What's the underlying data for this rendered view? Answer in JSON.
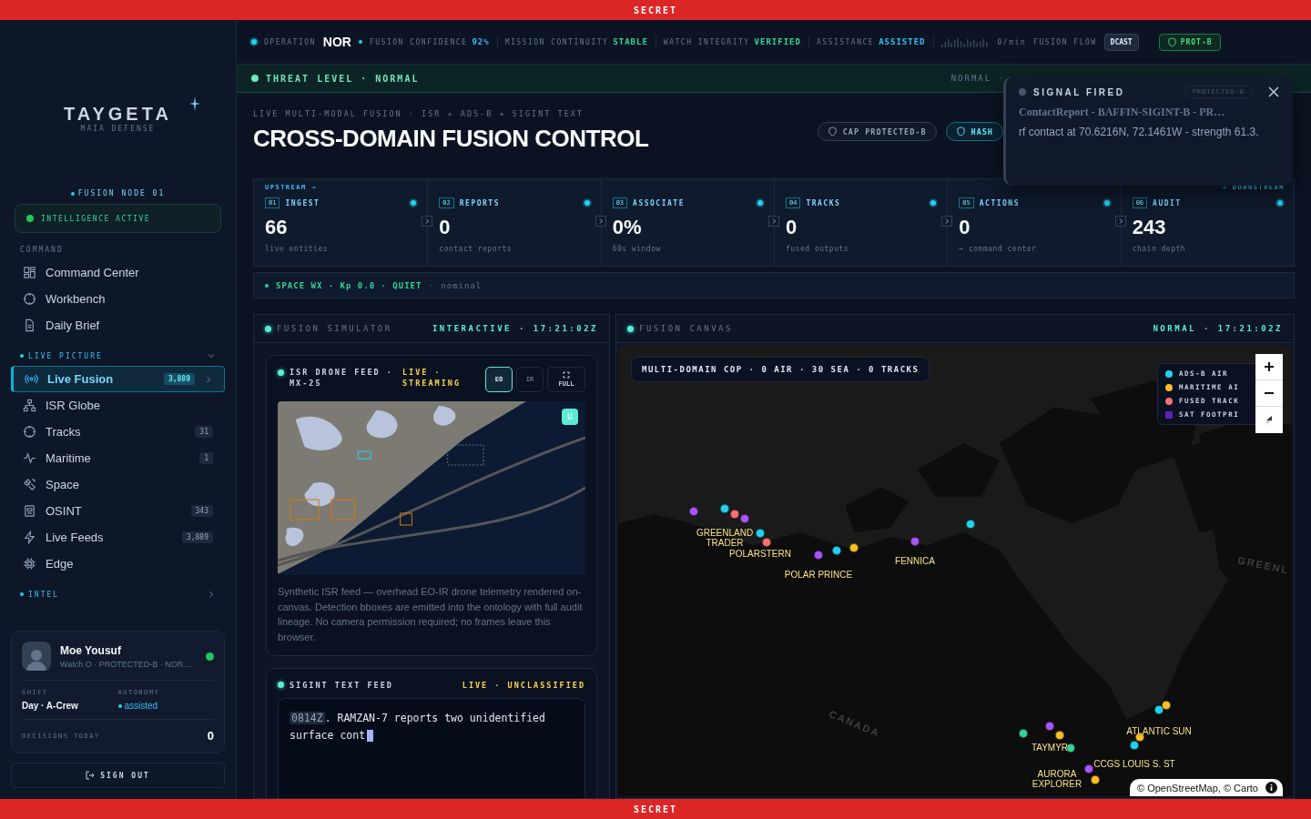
{
  "classification_banner_top": "SECRET",
  "classification_banner_bottom": "SECRET",
  "sidebar": {
    "logo": "TAYGETA",
    "logo_subtitle": "MAIA DEFENSE",
    "node": "FUSION NODE 01",
    "status": "INTELLIGENCE ACTIVE",
    "sections": [
      {
        "title": "COMMAND",
        "kind": "plain",
        "items": [
          {
            "label": "Command Center",
            "selected": false
          },
          {
            "label": "Workbench",
            "selected": false
          },
          {
            "label": "Daily Brief",
            "selected": false
          }
        ]
      },
      {
        "title": "LIVE PICTURE",
        "kind": "group",
        "expanded": true,
        "items": [
          {
            "label": "Live Fusion",
            "count": "3,889",
            "selected": true
          },
          {
            "label": "ISR Globe",
            "selected": false
          },
          {
            "label": "Tracks",
            "count": "31",
            "selected": false
          },
          {
            "label": "Maritime",
            "count": "1",
            "selected": false
          },
          {
            "label": "Space",
            "selected": false
          },
          {
            "label": "OSINT",
            "count": "343",
            "selected": false
          },
          {
            "label": "Live Feeds",
            "count": "3,889",
            "selected": false
          },
          {
            "label": "Edge",
            "selected": false
          }
        ]
      },
      {
        "title": "INTEL",
        "kind": "group",
        "expanded": false
      }
    ],
    "user": {
      "name": "Moe Yousuf",
      "subtitle": "Watch O · PROTECTED-B · NOR…",
      "online": true,
      "shift_label": "SHIFT",
      "shift": "Day · A-Crew",
      "autonomy_label": "AUTONOMY",
      "autonomy": "assisted",
      "decisions_label": "DECISIONS TODAY",
      "decisions": "0"
    },
    "sign_out": "SIGN OUT"
  },
  "top_bar": {
    "operation_label": "OPERATION",
    "operation": "NOR",
    "metrics": [
      {
        "label": "FUSION CONFIDENCE",
        "value": "92%",
        "color": "#38bdf8"
      },
      {
        "label": "MISSION CONTINUITY",
        "value": "STABLE",
        "color": "#34d399"
      },
      {
        "label": "WATCH INTEGRITY",
        "value": "VERIFIED",
        "color": "#34d399"
      },
      {
        "label": "ASSISTANCE",
        "value": "ASSISTED",
        "color": "#38bdf8"
      }
    ],
    "rate": "0/min",
    "flow_label": "FUSION FLOW",
    "broadcast_button": "DCAST",
    "badge": "PROT-B"
  },
  "threat_bar": {
    "label": "THREAT LEVEL · NORMAL",
    "scale": "NORMAL ·"
  },
  "header": {
    "eyebrow": "LIVE MULTI-MODAL FUSION · ISR + ADS-B + SIGINT TEXT",
    "title": "CROSS-DOMAIN FUSION CONTROL",
    "chips": [
      {
        "label": "CAP PROTECTED-B",
        "kind": "cap"
      },
      {
        "label": "HASH",
        "kind": "hash"
      }
    ]
  },
  "pipeline": {
    "upstream": "UPSTREAM →",
    "downstream": "→ DOWNSTREAM",
    "stages": [
      {
        "number": "01",
        "name": "INGEST",
        "value": "66",
        "caption": "live entities"
      },
      {
        "number": "02",
        "name": "REPORTS",
        "value": "0",
        "caption": "contact reports"
      },
      {
        "number": "03",
        "name": "ASSOCIATE",
        "value": "0%",
        "caption": "60s window"
      },
      {
        "number": "04",
        "name": "TRACKS",
        "value": "0",
        "caption": "fused outputs"
      },
      {
        "number": "05",
        "name": "ACTIONS",
        "value": "0",
        "caption": "→ command center"
      },
      {
        "number": "06",
        "name": "AUDIT",
        "value": "243",
        "caption": "chain depth"
      }
    ]
  },
  "space_weather": {
    "status": "SPACE WX · Kp 0.0 · QUIET",
    "note": "· nominal"
  },
  "simulator": {
    "title": "FUSION SIMULATOR",
    "status": "INTERACTIVE · 17:21:02Z",
    "drone_feed": {
      "title": "ISR DRONE FEED · MX-25",
      "status": "LIVE · STREAMING",
      "modes": [
        {
          "label": "EO",
          "selected": true
        },
        {
          "label": "IR",
          "selected": false
        }
      ],
      "full_button": "FULL",
      "overlay_badge": "U",
      "description": "Synthetic ISR feed — overhead EO-IR drone telemetry rendered on-canvas. Detection bboxes are emitted into the ontology with full audit lineage. No camera permission required; no frames leave this browser."
    },
    "sigint_feed": {
      "title": "SIGINT TEXT FEED",
      "status": "LIVE · UNCLASSIFIED",
      "timestamp": "0814Z",
      "text": ". RAMZAN-7 reports two unidentified surface cont"
    }
  },
  "fusion_canvas": {
    "title": "FUSION CANVAS",
    "status": "NORMAL · 17:21:02Z",
    "summary": "MULTI-DOMAIN COP · 0 AIR · 30 SEA · 0 TRACKS",
    "legend": [
      {
        "label": "ADS-B AIR",
        "color": "#22d3ee"
      },
      {
        "label": "MARITIME AI",
        "color": "#fbbf24"
      },
      {
        "label": "FUSED TRACK",
        "color": "#f87171"
      },
      {
        "label": "SAT FOOTPRI",
        "color": "#5b21b6"
      }
    ],
    "region_labels": [
      "CANADA",
      "GREENL"
    ],
    "vessels": [
      {
        "label": "GREENLAND TRADER"
      },
      {
        "label": "POLARSTERN"
      },
      {
        "label": "POLAR PRINCE"
      },
      {
        "label": "FENNICA"
      },
      {
        "label": "ATLANTIC SUN"
      },
      {
        "label": "TAYMYR"
      },
      {
        "label": "AURORA EXPLORER"
      },
      {
        "label": "CCGS LOUIS S. ST"
      }
    ],
    "markers": [
      {
        "color": "#a855f7"
      },
      {
        "color": "#22d3ee"
      },
      {
        "color": "#f87171"
      },
      {
        "color": "#a855f7"
      },
      {
        "color": "#22d3ee"
      },
      {
        "color": "#f87171"
      },
      {
        "color": "#a855f7"
      },
      {
        "color": "#22d3ee"
      },
      {
        "color": "#fbbf24"
      },
      {
        "color": "#a855f7"
      },
      {
        "color": "#22d3ee"
      },
      {
        "color": "#34d399"
      },
      {
        "color": "#a855f7"
      },
      {
        "color": "#fbbf24"
      },
      {
        "color": "#34d399"
      },
      {
        "color": "#22d3ee"
      },
      {
        "color": "#fbbf24"
      },
      {
        "color": "#22d3ee"
      },
      {
        "color": "#fbbf24"
      },
      {
        "color": "#fbbf24"
      },
      {
        "color": "#a855f7"
      }
    ],
    "attribution": "© OpenStreetMap, © Carto"
  },
  "toast": {
    "title": "SIGNAL FIRED",
    "badge": "PROTECTED-B",
    "heading": "ContactReport - BAFFIN-SIGINT-B - PR…",
    "body": "rf contact at 70.6216N, 72.1461W - strength 61.3."
  }
}
